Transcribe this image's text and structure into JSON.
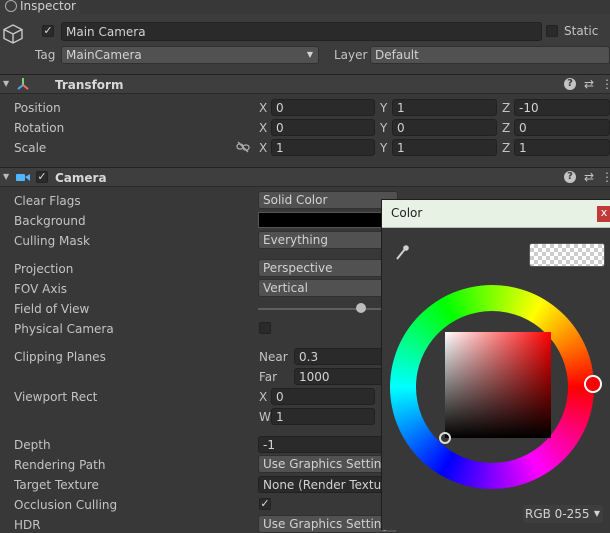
{
  "tab": {
    "title": "Inspector"
  },
  "object": {
    "name": "Main Camera",
    "static_label": "Static",
    "tag_label": "Tag",
    "tag_value": "MainCamera",
    "layer_label": "Layer",
    "layer_value": "Default"
  },
  "transform": {
    "title": "Transform",
    "rows": [
      {
        "label": "Position",
        "x": "0",
        "y": "1",
        "z": "-10"
      },
      {
        "label": "Rotation",
        "x": "0",
        "y": "0",
        "z": "0"
      },
      {
        "label": "Scale",
        "x": "1",
        "y": "1",
        "z": "1"
      }
    ],
    "axes": {
      "x": "X",
      "y": "Y",
      "z": "Z"
    }
  },
  "camera": {
    "title": "Camera",
    "clear_flags": {
      "label": "Clear Flags",
      "value": "Solid Color"
    },
    "background": {
      "label": "Background",
      "color": "#000000"
    },
    "culling_mask": {
      "label": "Culling Mask",
      "value": "Everything"
    },
    "projection": {
      "label": "Projection",
      "value": "Perspective"
    },
    "fov_axis": {
      "label": "FOV Axis",
      "value": "Vertical"
    },
    "field_of_view": {
      "label": "Field of View"
    },
    "physical_camera": {
      "label": "Physical Camera"
    },
    "clipping_planes": {
      "label": "Clipping Planes",
      "near_label": "Near",
      "near": "0.3",
      "far_label": "Far",
      "far": "1000"
    },
    "viewport_rect": {
      "label": "Viewport Rect",
      "x_label": "X",
      "x": "0",
      "w_label": "W",
      "w": "1"
    },
    "depth": {
      "label": "Depth",
      "value": "-1"
    },
    "rendering_path": {
      "label": "Rendering Path",
      "value": "Use Graphics Settings"
    },
    "target_texture": {
      "label": "Target Texture",
      "value": "None (Render Texture"
    },
    "occlusion_culling": {
      "label": "Occlusion Culling",
      "checkmark": "✓"
    },
    "hdr": {
      "label": "HDR",
      "value": "Use Graphics Settings"
    }
  },
  "color_picker": {
    "title": "Color",
    "close_label": "x",
    "mode": "RGB 0-255",
    "current_color": "#ff0000"
  },
  "glyphs": {
    "check": "✓",
    "help": "?",
    "presets": "⇄",
    "menu": "⋮",
    "fold": "▼",
    "drop": "▼"
  }
}
